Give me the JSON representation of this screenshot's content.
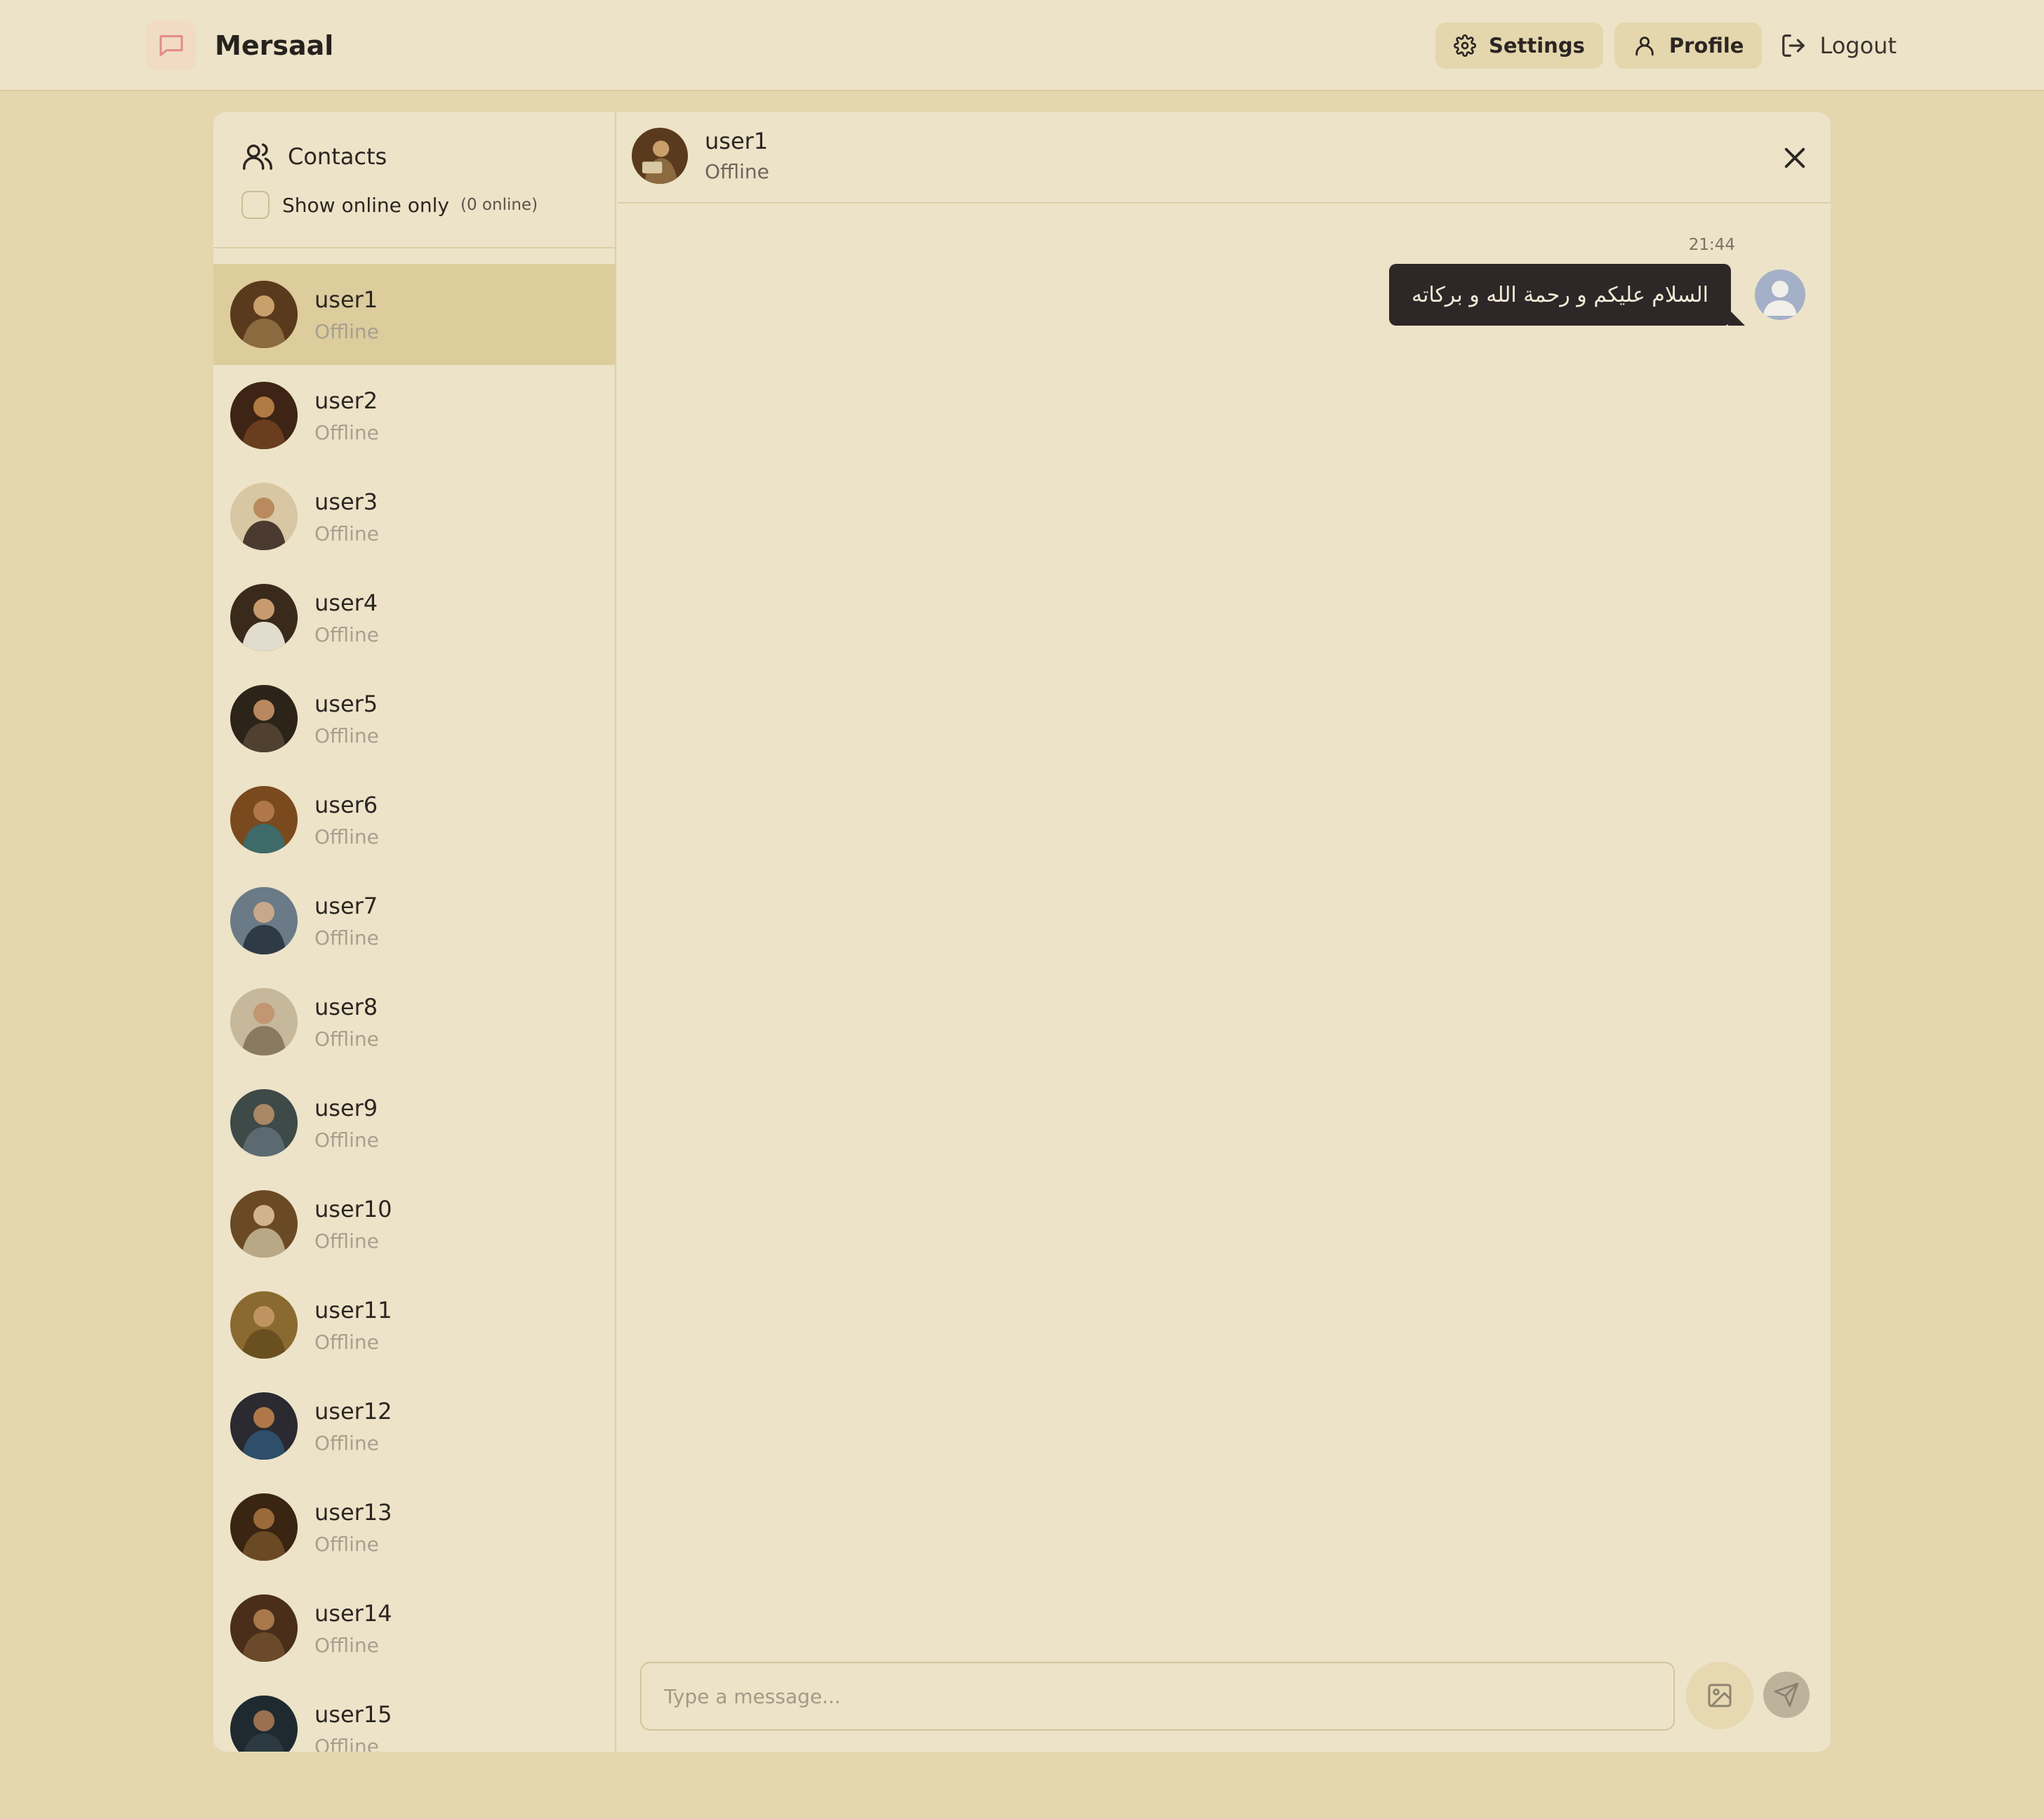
{
  "app": {
    "name": "Mersaal"
  },
  "nav": {
    "settings_label": "Settings",
    "profile_label": "Profile",
    "logout_label": "Logout"
  },
  "sidebar": {
    "title": "Contacts",
    "online_toggle_label": "Show online only",
    "online_count": "(0 online)",
    "contacts": [
      {
        "name": "user1",
        "status": "Offline"
      },
      {
        "name": "user2",
        "status": "Offline"
      },
      {
        "name": "user3",
        "status": "Offline"
      },
      {
        "name": "user4",
        "status": "Offline"
      },
      {
        "name": "user5",
        "status": "Offline"
      },
      {
        "name": "user6",
        "status": "Offline"
      },
      {
        "name": "user7",
        "status": "Offline"
      },
      {
        "name": "user8",
        "status": "Offline"
      },
      {
        "name": "user9",
        "status": "Offline"
      },
      {
        "name": "user10",
        "status": "Offline"
      },
      {
        "name": "user11",
        "status": "Offline"
      },
      {
        "name": "user12",
        "status": "Offline"
      },
      {
        "name": "user13",
        "status": "Offline"
      },
      {
        "name": "user14",
        "status": "Offline"
      },
      {
        "name": "user15",
        "status": "Offline"
      }
    ]
  },
  "chat": {
    "user_name": "user1",
    "user_status": "Offline",
    "messages": [
      {
        "time": "21:44",
        "text": "السلام عليكم و رحمة الله و بركاته"
      }
    ],
    "input_placeholder": "Type a message..."
  },
  "colors": {
    "background": "#e4d7ae",
    "panel": "#ede3c8",
    "active_contact": "#ddcc9c",
    "bubble": "#2d2727",
    "logo_accent": "#e48a8a"
  }
}
